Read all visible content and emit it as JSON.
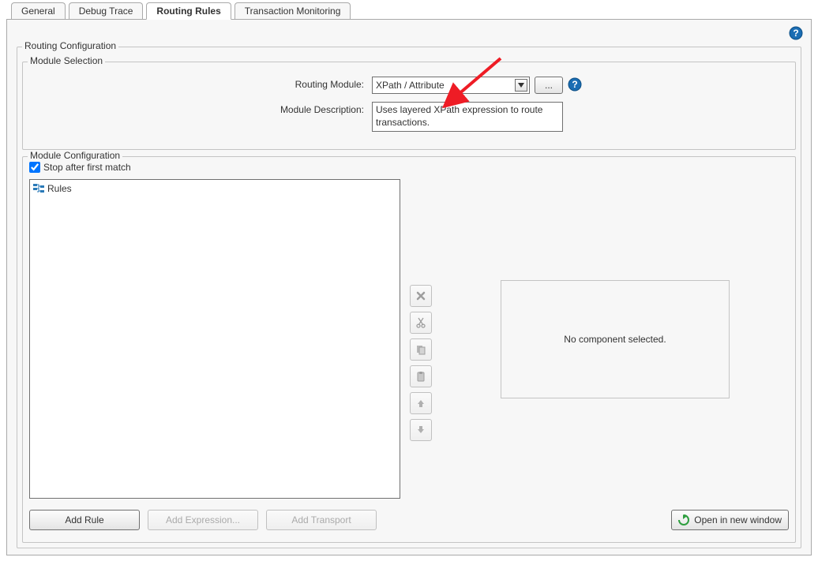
{
  "tabs": {
    "general": "General",
    "debug": "Debug Trace",
    "routing": "Routing Rules",
    "tx": "Transaction Monitoring"
  },
  "groups": {
    "routing_config": "Routing Configuration",
    "module_selection": "Module Selection",
    "module_config": "Module Configuration"
  },
  "form": {
    "routing_module_label": "Routing Module:",
    "routing_module_value": "XPath / Attribute",
    "browse": "...",
    "module_description_label": "Module Description:",
    "module_description_value": "Uses layered XPath expression to route transactions."
  },
  "config": {
    "stop_label": "Stop after first match",
    "stop_checked": true,
    "rules_root": "Rules",
    "empty": "No component selected."
  },
  "btncol": {
    "delete": "delete",
    "cut": "cut",
    "copy": "copy",
    "paste": "paste",
    "up": "move-up",
    "down": "move-down"
  },
  "bottom": {
    "add_rule": "Add Rule",
    "add_expr": "Add Expression...",
    "add_transport": "Add Transport",
    "open_new": "Open in new window"
  }
}
